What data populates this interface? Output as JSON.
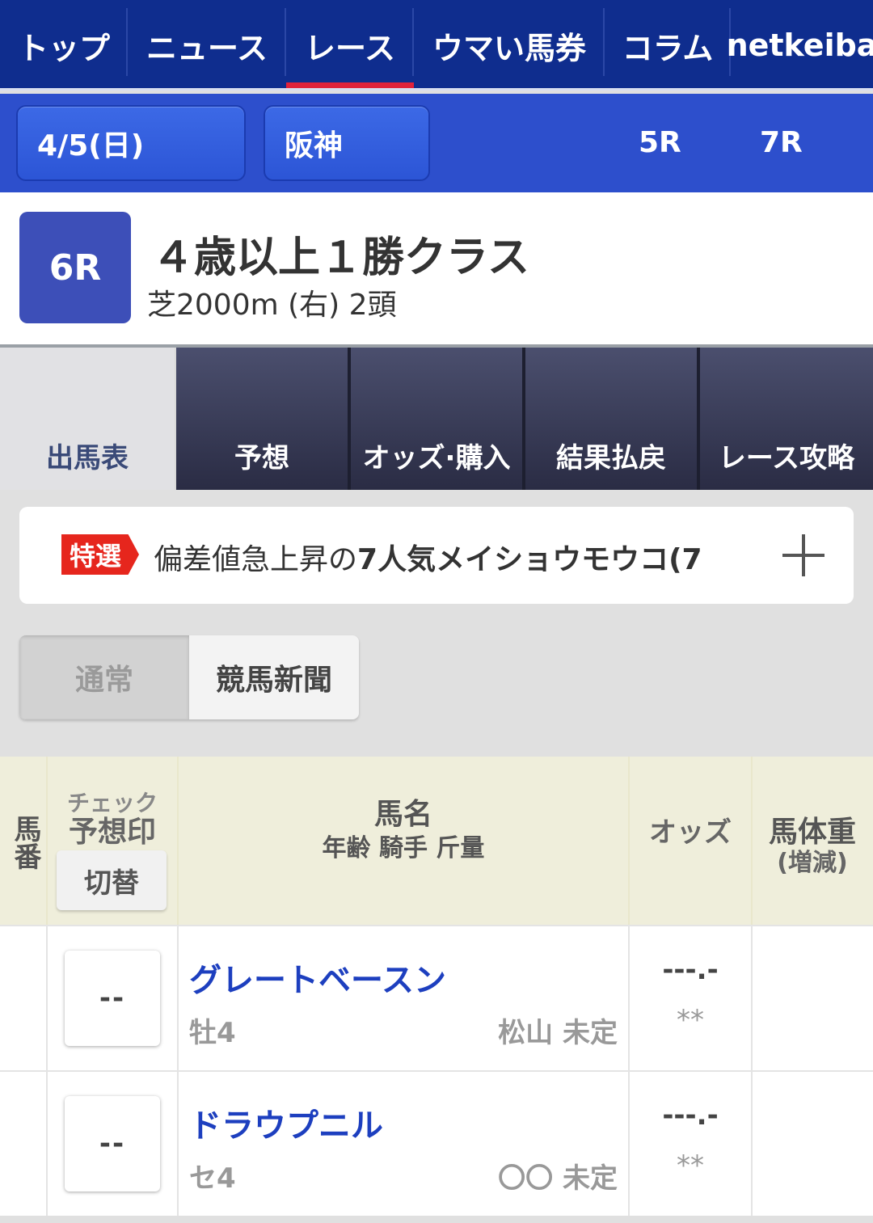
{
  "nav": {
    "tabs": [
      "トップ",
      "ニュース",
      "レース",
      "ウマい馬券",
      "コラム",
      "netkeiba"
    ],
    "active": "レース"
  },
  "race_bar": {
    "date": "4/5(日)",
    "venue": "阪神",
    "prev_race": "5R",
    "next_race": "7R"
  },
  "race": {
    "number": "6R",
    "title": "４歳以上１勝クラス",
    "details": "芝2000m (右) 2頭"
  },
  "section_tabs": [
    "出馬表",
    "予想",
    "オッズ·購入",
    "結果払戻",
    "レース攻略"
  ],
  "promo": {
    "tag": "特選",
    "text_normal": "偏差値急上昇の",
    "text_bold": "7人気メイショウモウコ(7"
  },
  "view_toggle": {
    "normal": "通常",
    "newspaper": "競馬新聞"
  },
  "table": {
    "headers": {
      "umaban": "馬番",
      "check": "チェック",
      "yoso": "予想印",
      "switch": "切替",
      "name": "馬名",
      "name_sub": "年齢 騎手 斤量",
      "odds": "オッズ",
      "weight": "馬体重",
      "weight_sub": "(増減)"
    },
    "rows": [
      {
        "mark": "--",
        "name": "グレートベースン",
        "sex_age": "牡4",
        "jockey": "松山 未定",
        "odds": "---.-",
        "popularity": "**"
      },
      {
        "mark": "--",
        "name": "ドラウプニル",
        "sex_age": "セ4",
        "jockey": "〇〇 未定",
        "odds": "---.-",
        "popularity": "**"
      }
    ]
  },
  "colors": {
    "nav_bg": "#0f2d8e",
    "race_bar_bg": "#2d4fcc",
    "active_underline": "#e0213b",
    "badge_bg": "#3d4fb8",
    "horse_name": "#1d3fbf",
    "promo_tag": "#e6261d",
    "table_header_bg": "#efeedb"
  }
}
